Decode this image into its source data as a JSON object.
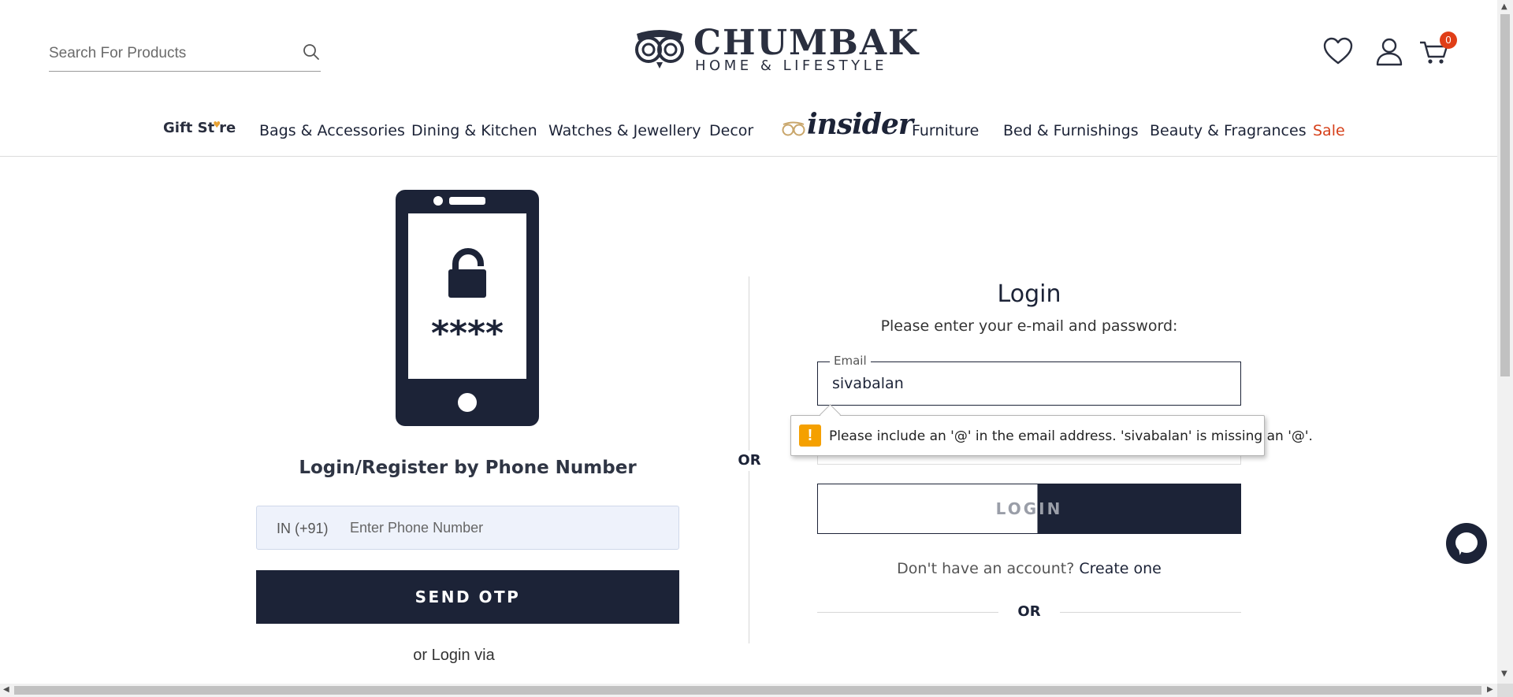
{
  "header": {
    "search_placeholder": "Search For Products",
    "logo_name": "CHUMBAK",
    "logo_tagline": "HOME & LIFESTYLE",
    "cart_count": "0"
  },
  "nav": {
    "gift_pre": "Gift St",
    "gift_post": "re",
    "items": [
      {
        "label": "Bags & Accessories"
      },
      {
        "label": "Dining & Kitchen"
      },
      {
        "label": "Watches & Jewellery"
      },
      {
        "label": "Decor"
      },
      {
        "label": "Furniture"
      },
      {
        "label": "Bed & Furnishings"
      },
      {
        "label": "Beauty & Fragrances"
      },
      {
        "label": "Sale"
      }
    ],
    "insider_label": "insider"
  },
  "phone_login": {
    "illustration_text": "****",
    "heading": "Login/Register by Phone Number",
    "country_code": "IN (+91)",
    "phone_placeholder": "Enter Phone Number",
    "send_otp_label": "SEND OTP",
    "login_via": "or Login via"
  },
  "divider_or": "OR",
  "email_login": {
    "title": "Login",
    "subtitle": "Please enter your e-mail and password:",
    "email_label": "Email",
    "email_value": "sivabalan",
    "login_label": "LOGIN",
    "no_account": "Don't have an account? ",
    "create_link": "Create one",
    "or_label": "OR"
  },
  "validation": {
    "icon": "!",
    "message": "Please include an '@' in the email address. 'sivabalan' is missing an '@'."
  },
  "colors": {
    "brand_navy": "#1c2337",
    "sale_red": "#d6401a",
    "badge": "#e03e17",
    "warning": "#f5a000"
  }
}
